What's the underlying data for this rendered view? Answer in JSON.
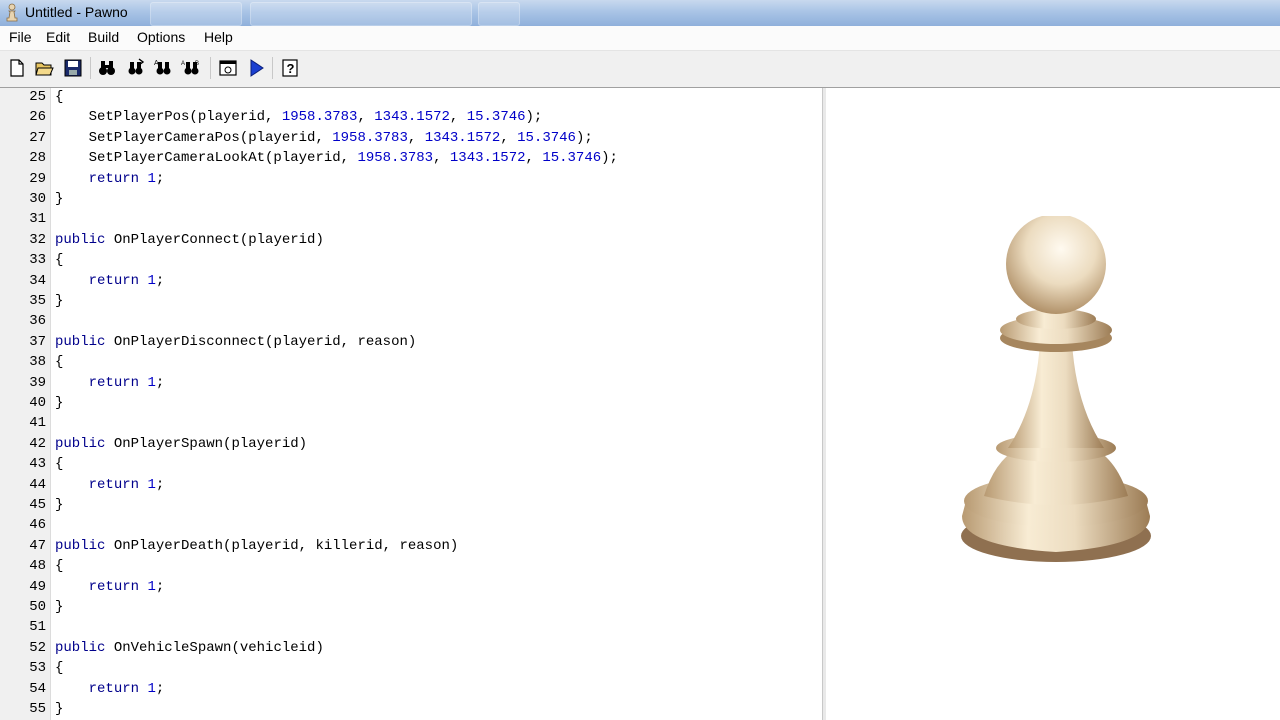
{
  "window": {
    "title": "Untitled - Pawno"
  },
  "menu": [
    "File",
    "Edit",
    "Build",
    "Options",
    "Help"
  ],
  "toolbar": {
    "buttons": [
      "new-file",
      "open-file",
      "save-file",
      "find",
      "find-next",
      "replace",
      "goto-line",
      "compile-run",
      "help"
    ]
  },
  "editor": {
    "lines": [
      {
        "n": "25",
        "parts": [
          {
            "t": "{"
          }
        ]
      },
      {
        "n": "26",
        "parts": [
          {
            "t": "    SetPlayerPos(playerid, "
          },
          {
            "t": "1958.3783",
            "c": "num"
          },
          {
            "t": ", "
          },
          {
            "t": "1343.1572",
            "c": "num"
          },
          {
            "t": ", "
          },
          {
            "t": "15.3746",
            "c": "num"
          },
          {
            "t": ");"
          }
        ]
      },
      {
        "n": "27",
        "parts": [
          {
            "t": "    SetPlayerCameraPos(playerid, "
          },
          {
            "t": "1958.3783",
            "c": "num"
          },
          {
            "t": ", "
          },
          {
            "t": "1343.1572",
            "c": "num"
          },
          {
            "t": ", "
          },
          {
            "t": "15.3746",
            "c": "num"
          },
          {
            "t": ");"
          }
        ]
      },
      {
        "n": "28",
        "parts": [
          {
            "t": "    SetPlayerCameraLookAt(playerid, "
          },
          {
            "t": "1958.3783",
            "c": "num"
          },
          {
            "t": ", "
          },
          {
            "t": "1343.1572",
            "c": "num"
          },
          {
            "t": ", "
          },
          {
            "t": "15.3746",
            "c": "num"
          },
          {
            "t": ");"
          }
        ]
      },
      {
        "n": "29",
        "parts": [
          {
            "t": "    "
          },
          {
            "t": "return",
            "c": "kw"
          },
          {
            "t": " "
          },
          {
            "t": "1",
            "c": "num"
          },
          {
            "t": ";"
          }
        ]
      },
      {
        "n": "30",
        "parts": [
          {
            "t": "}"
          }
        ]
      },
      {
        "n": "31",
        "parts": [
          {
            "t": ""
          }
        ]
      },
      {
        "n": "32",
        "parts": [
          {
            "t": "public",
            "c": "kw"
          },
          {
            "t": " OnPlayerConnect(playerid)"
          }
        ]
      },
      {
        "n": "33",
        "parts": [
          {
            "t": "{"
          }
        ]
      },
      {
        "n": "34",
        "parts": [
          {
            "t": "    "
          },
          {
            "t": "return",
            "c": "kw"
          },
          {
            "t": " "
          },
          {
            "t": "1",
            "c": "num"
          },
          {
            "t": ";"
          }
        ]
      },
      {
        "n": "35",
        "parts": [
          {
            "t": "}"
          }
        ]
      },
      {
        "n": "36",
        "parts": [
          {
            "t": ""
          }
        ]
      },
      {
        "n": "37",
        "parts": [
          {
            "t": "public",
            "c": "kw"
          },
          {
            "t": " OnPlayerDisconnect(playerid, reason)"
          }
        ]
      },
      {
        "n": "38",
        "parts": [
          {
            "t": "{"
          }
        ]
      },
      {
        "n": "39",
        "parts": [
          {
            "t": "    "
          },
          {
            "t": "return",
            "c": "kw"
          },
          {
            "t": " "
          },
          {
            "t": "1",
            "c": "num"
          },
          {
            "t": ";"
          }
        ]
      },
      {
        "n": "40",
        "parts": [
          {
            "t": "}"
          }
        ]
      },
      {
        "n": "41",
        "parts": [
          {
            "t": ""
          }
        ]
      },
      {
        "n": "42",
        "parts": [
          {
            "t": "public",
            "c": "kw"
          },
          {
            "t": " OnPlayerSpawn(playerid)"
          }
        ]
      },
      {
        "n": "43",
        "parts": [
          {
            "t": "{"
          }
        ]
      },
      {
        "n": "44",
        "parts": [
          {
            "t": "    "
          },
          {
            "t": "return",
            "c": "kw"
          },
          {
            "t": " "
          },
          {
            "t": "1",
            "c": "num"
          },
          {
            "t": ";"
          }
        ]
      },
      {
        "n": "45",
        "parts": [
          {
            "t": "}"
          }
        ]
      },
      {
        "n": "46",
        "parts": [
          {
            "t": ""
          }
        ]
      },
      {
        "n": "47",
        "parts": [
          {
            "t": "public",
            "c": "kw"
          },
          {
            "t": " OnPlayerDeath(playerid, killerid, reason)"
          }
        ]
      },
      {
        "n": "48",
        "parts": [
          {
            "t": "{"
          }
        ]
      },
      {
        "n": "49",
        "parts": [
          {
            "t": "    "
          },
          {
            "t": "return",
            "c": "kw"
          },
          {
            "t": " "
          },
          {
            "t": "1",
            "c": "num"
          },
          {
            "t": ";"
          }
        ]
      },
      {
        "n": "50",
        "parts": [
          {
            "t": "}"
          }
        ]
      },
      {
        "n": "51",
        "parts": [
          {
            "t": ""
          }
        ]
      },
      {
        "n": "52",
        "parts": [
          {
            "t": "public",
            "c": "kw"
          },
          {
            "t": " OnVehicleSpawn(vehicleid)"
          }
        ]
      },
      {
        "n": "53",
        "parts": [
          {
            "t": "{"
          }
        ]
      },
      {
        "n": "54",
        "parts": [
          {
            "t": "    "
          },
          {
            "t": "return",
            "c": "kw"
          },
          {
            "t": " "
          },
          {
            "t": "1",
            "c": "num"
          },
          {
            "t": ";"
          }
        ]
      },
      {
        "n": "55",
        "parts": [
          {
            "t": "}"
          }
        ]
      }
    ]
  },
  "colors": {
    "keyword": "#00008b",
    "number": "#0000c8",
    "gutter": "#f0f0f0",
    "pawn": "#ecdcc0"
  },
  "preview": {
    "icon": "pawn-chess-piece"
  }
}
